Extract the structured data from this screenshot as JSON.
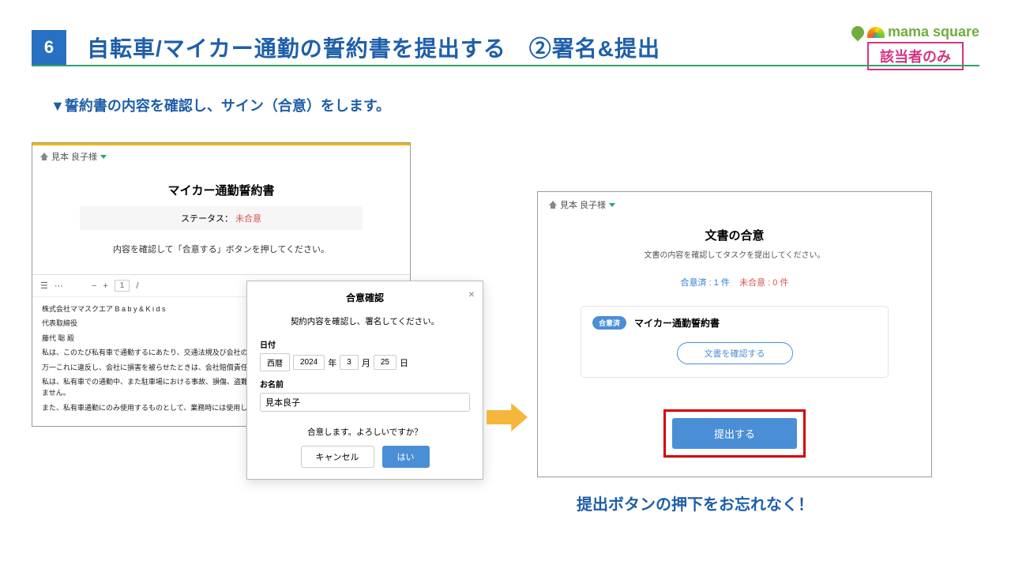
{
  "header": {
    "step_number": "6",
    "title": "自転車/マイカー通勤の誓約書を提出する　②署名&提出",
    "logo_text": "mama square",
    "notice_badge": "該当者のみ"
  },
  "subtitle": "▼誓約書の内容を確認し、サイン（合意）をします。",
  "left_panel": {
    "user_name": "見本 良子様",
    "pledge_title": "マイカー通勤誓約書",
    "status_label": "ステータス：",
    "status_value": "未合意",
    "hint": "内容を確認して「合意する」ボタンを押してください。",
    "pdf_toolbar_page": "1",
    "pdf_body": {
      "line1": "株式会社ママスクエア B a b y & K i d s",
      "line2": "代表取締役",
      "line3": "藤代 聡 殿",
      "p1": "私は、このたび私有車で通勤するにあたり、交通法規及び会社の定めに反さないよう安全運転に努めます。",
      "p2": "万一これに違反し、会社に損害を被らせたときは、会社賠償責任の……",
      "p3": "私は、私有車での通勤中、また駐車場における事故、損傷、盗難等……決し、会社に一切ご迷惑をおかけいたしません。",
      "p4": "また、私有車通勤にのみ使用するものとして、業務時には使用し……"
    }
  },
  "modal": {
    "title": "合意確認",
    "hint": "契約内容を確認し、署名してください。",
    "date_label": "日付",
    "era": "西暦",
    "year": "2024",
    "year_suffix": "年",
    "month": "3",
    "month_suffix": "月",
    "day": "25",
    "day_suffix": "日",
    "name_label": "お名前",
    "name_value": "見本良子",
    "confirm_text": "合意します。よろしいですか？",
    "cancel": "キャンセル",
    "ok": "はい"
  },
  "right_panel": {
    "user_name": "見本 良子様",
    "title": "文書の合意",
    "sub": "文書の内容を確認してタスクを提出してください。",
    "count_agreed_label": "合意済 : ",
    "count_agreed_value": "1 件",
    "count_pending_label": "未合意 : ",
    "count_pending_value": "0 件",
    "chip": "合意済",
    "doc_name": "マイカー通勤誓約書",
    "confirm_doc": "文書を確認する",
    "submit": "提出する"
  },
  "reminder": "提出ボタンの押下をお忘れなく！"
}
